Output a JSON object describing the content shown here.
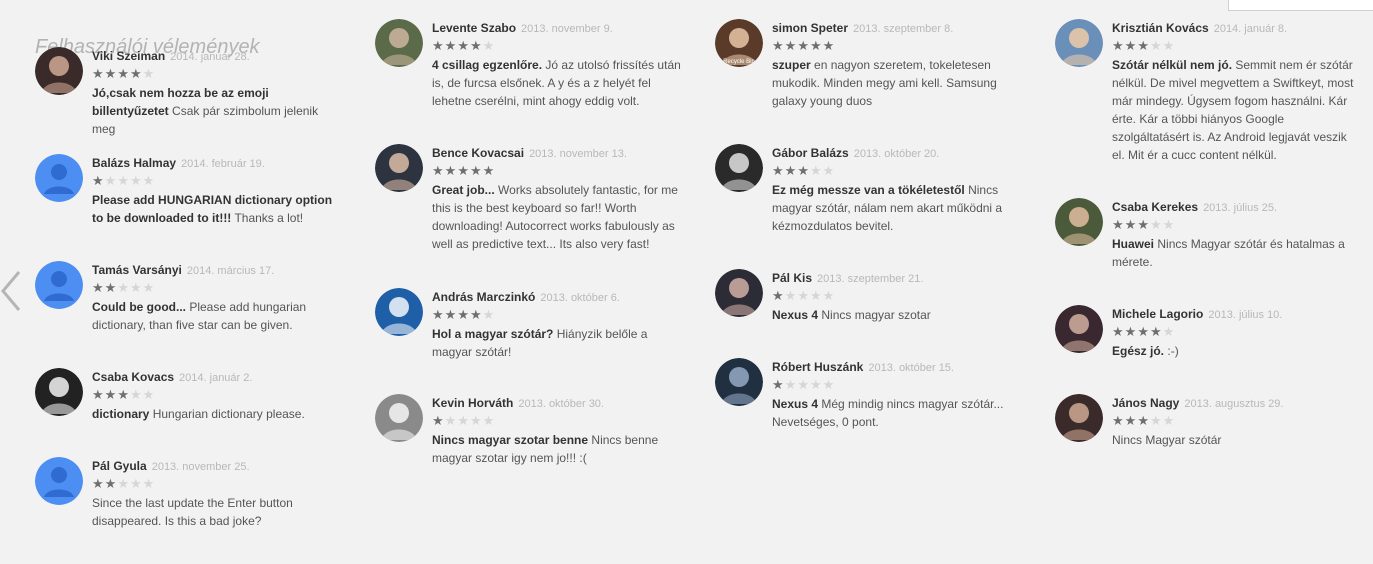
{
  "heading": "Felhasználói vélemények",
  "colors": {
    "star_on": "#6f6f6f",
    "star_off": "#d6d6d6",
    "default_avatar": "#4d8ef2"
  },
  "columns": [
    [
      {
        "name": "Viki Szeiman",
        "date": "2014. január 28.",
        "rating": 4,
        "title": "Jó,csak nem hozza be az emoji billentyűzetet",
        "text": "Csak pár szimbolum jelenik meg",
        "avatar": "photo"
      },
      {
        "name": "Balázs Halmay",
        "date": "2014. február 19.",
        "rating": 1,
        "title": "Please add HUNGARIAN dictionary option to be downloaded to it!!!",
        "text": "Thanks a lot!",
        "avatar": "default"
      },
      {
        "name": "Tamás Varsányi",
        "date": "2014. március 17.",
        "rating": 2,
        "title": "Could be good...",
        "text": "Please add hungarian dictionary, than five star can be given.",
        "avatar": "default"
      },
      {
        "name": "Csaba Kovacs",
        "date": "2014. január 2.",
        "rating": 3,
        "title": "dictionary",
        "text": "Hungarian dictionary please.",
        "avatar": "photo"
      },
      {
        "name": "Pál Gyula",
        "date": "2013. november 25.",
        "rating": 2,
        "title": "",
        "text": "Since the last update the Enter button disappeared. Is this a bad joke?",
        "avatar": "default"
      }
    ],
    [
      {
        "name": "Levente Szabo",
        "date": "2013. november 9.",
        "rating": 4,
        "title": "4 csillag egzenlőre.",
        "text": "Jó az utolsó frissítés után is, de furcsa elsőnek. A y és a z helyét fel lehetne cserélni, mint ahogy eddig volt.",
        "avatar": "photo"
      },
      {
        "name": "Bence Kovacsai",
        "date": "2013. november 13.",
        "rating": 5,
        "title": "Great job...",
        "text": "Works absolutely fantastic, for me this is the best keyboard so far!! Worth downloading! Autocorrect works fabulously as well as predictive text... Its also very fast!",
        "avatar": "photo"
      },
      {
        "name": "András Marczinkó",
        "date": "2013. október 6.",
        "rating": 4,
        "title": "Hol a magyar szótár?",
        "text": "Hiányzik belőle a magyar szótár!",
        "avatar": "photo"
      },
      {
        "name": "Kevin Horváth",
        "date": "2013. október 30.",
        "rating": 1,
        "title": "Nincs magyar szotar benne",
        "text": "Nincs benne magyar szotar igy nem jo!!! :(",
        "avatar": "photo"
      }
    ],
    [
      {
        "name": "simon Speter",
        "date": "2013. szeptember 8.",
        "rating": 5,
        "title": "szuper",
        "text": "en nagyon szeretem, tokeletesen mukodik. Minden megy ami kell. Samsung galaxy young duos",
        "avatar": "photo",
        "avatar_caption": "Recycle Bin"
      },
      {
        "name": "Gábor Balázs",
        "date": "2013. október 20.",
        "rating": 3,
        "title": "Ez még messze van a tökéletestől",
        "text": "Nincs magyar szótár, nálam nem akart működni a kézmozdulatos bevitel.",
        "avatar": "photo"
      },
      {
        "name": "Pál Kis",
        "date": "2013. szeptember 21.",
        "rating": 1,
        "title": "Nexus 4",
        "text": "Nincs magyar szotar",
        "avatar": "photo"
      },
      {
        "name": "Róbert Huszánk",
        "date": "2013. október 15.",
        "rating": 1,
        "title": "Nexus 4",
        "text": "Még mindig nincs magyar szótár... Nevetséges, 0 pont.",
        "avatar": "photo"
      }
    ],
    [
      {
        "name": "Krisztián Kovács",
        "date": "2014. január 8.",
        "rating": 3,
        "title": "Szótár nélkül nem jó.",
        "text": "Semmit nem ér szótár nélkül. De mivel megvettem a Swiftkeyt, most már mindegy. Úgysem fogom használni. Kár érte. Kár a többi hiányos Google szolgáltatásért is. Az Android legjavát veszik el. Mit ér a cucc content nélkül.",
        "avatar": "photo"
      },
      {
        "name": "Csaba Kerekes",
        "date": "2013. július 25.",
        "rating": 3,
        "title": "Huawei",
        "text": "Nincs Magyar szótár és hatalmas a mérete.",
        "avatar": "photo"
      },
      {
        "name": "Michele Lagorio",
        "date": "2013. július 10.",
        "rating": 4,
        "title": "Egész jó.",
        "text": ":-)",
        "avatar": "photo"
      },
      {
        "name": "János Nagy",
        "date": "2013. augusztus 29.",
        "rating": 3,
        "title": "",
        "text": "Nincs Magyar szótár",
        "avatar": "photo"
      }
    ]
  ]
}
